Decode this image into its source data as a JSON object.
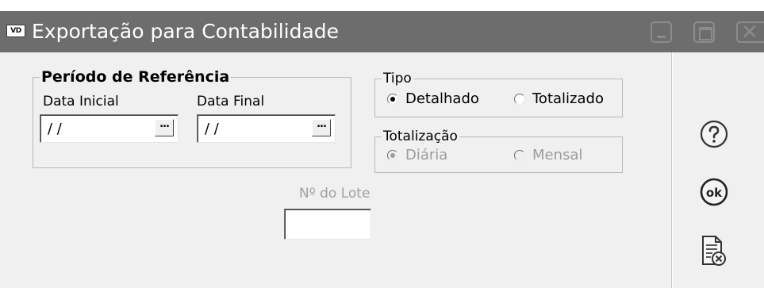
{
  "window": {
    "icon_text": "VD",
    "title": "Exportação para Contabilidade"
  },
  "periodo": {
    "legend": "Período de Referência",
    "data_inicial_label": "Data Inicial",
    "data_inicial_value": "/ /",
    "data_final_label": "Data Final",
    "data_final_value": "/ /",
    "picker_label": "..."
  },
  "tipo": {
    "legend": "Tipo",
    "options": [
      {
        "label": "Detalhado",
        "checked": true
      },
      {
        "label": "Totalizado",
        "checked": false
      }
    ]
  },
  "totalizacao": {
    "legend": "Totalização",
    "enabled": false,
    "options": [
      {
        "label": "Diária",
        "checked": true
      },
      {
        "label": "Mensal",
        "checked": false
      }
    ]
  },
  "lote": {
    "label": "Nº do Lote",
    "value": ""
  },
  "sidebar": {
    "help_icon": "help-circle-icon",
    "ok_icon": "ok-circle-icon",
    "cancel_icon": "document-cancel-icon"
  }
}
